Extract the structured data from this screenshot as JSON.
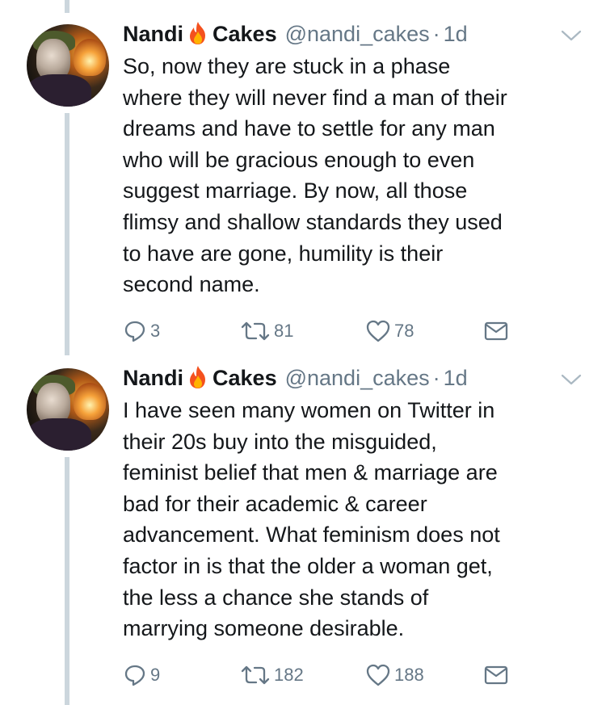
{
  "tweets": [
    {
      "display_name_first": "Nandi",
      "display_name_emoji": "fire-emoji",
      "display_name_last": "Cakes",
      "handle": "@nandi_cakes",
      "time": "1d",
      "lines": [
        "So, now they are stuck in a phase",
        "where they will never find a man of their",
        "dreams and have to settle for any man",
        "who will be gracious enough to even",
        "suggest marriage. By now, all those",
        "flimsy and shallow standards they used",
        "to have are gone, humility is their",
        "second name."
      ],
      "replies": "3",
      "retweets": "81",
      "likes": "78"
    },
    {
      "display_name_first": "Nandi",
      "display_name_emoji": "fire-emoji",
      "display_name_last": "Cakes",
      "handle": "@nandi_cakes",
      "time": "1d",
      "lines": [
        "I have seen many women on Twitter in",
        "their 20s buy into the misguided,",
        "feminist belief that men & marriage are",
        "bad for their academic & career",
        "advancement. What feminism does not",
        "factor in is that the older a woman get,",
        "the less a chance she stands of",
        "marrying someone desirable."
      ],
      "replies": "9",
      "retweets": "182",
      "likes": "188"
    }
  ],
  "icons": {
    "reply": "reply-icon",
    "retweet": "retweet-icon",
    "like": "heart-icon",
    "message": "envelope-icon",
    "menu": "chevron-down-icon"
  },
  "colors": {
    "text": "#14171a",
    "secondary": "#657786",
    "thread_line": "#ccd6dd"
  }
}
